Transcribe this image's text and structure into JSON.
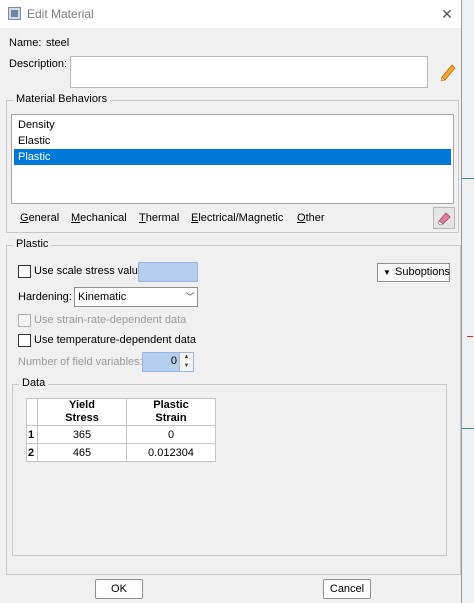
{
  "window": {
    "title": "Edit Material",
    "close_icon": "close-icon"
  },
  "name": {
    "label": "Name:",
    "value": "steel"
  },
  "description": {
    "label": "Description:",
    "value": "",
    "edit_icon": "pencil-icon"
  },
  "behaviors": {
    "title": "Material Behaviors",
    "items": [
      "Density",
      "Elastic",
      "Plastic"
    ],
    "selected": "Plastic",
    "selection_color": "#0078d7"
  },
  "menu": {
    "items": [
      {
        "mnemonic": "G",
        "rest": "eneral"
      },
      {
        "mnemonic": "M",
        "rest": "echanical"
      },
      {
        "mnemonic": "T",
        "rest": "hermal"
      },
      {
        "mnemonic": "E",
        "rest": "lectrical/Magnetic"
      },
      {
        "mnemonic": "O",
        "rest": "ther"
      }
    ],
    "delete_icon": "eraser-icon"
  },
  "plastic": {
    "title": "Plastic",
    "use_scale_stress": {
      "label": "Use scale stress value:",
      "checked": false,
      "value": ""
    },
    "suboptions_label": "Suboptions",
    "hardening": {
      "label": "Hardening:",
      "value": "Kinematic"
    },
    "strain_rate": {
      "label": "Use strain-rate-dependent data",
      "checked": false,
      "enabled": false
    },
    "temperature": {
      "label": "Use temperature-dependent data",
      "checked": false
    },
    "field_vars": {
      "label": "Number of field variables:",
      "value": "0"
    }
  },
  "data": {
    "title": "Data",
    "columns": [
      {
        "line1": "Yield",
        "line2": "Stress"
      },
      {
        "line1": "Plastic",
        "line2": "Strain"
      }
    ],
    "rows": [
      {
        "index": "1",
        "cells": [
          "365",
          "0"
        ]
      },
      {
        "index": "2",
        "cells": [
          "465",
          "0.012304"
        ]
      }
    ]
  },
  "footer": {
    "ok": "OK",
    "cancel": "Cancel"
  }
}
